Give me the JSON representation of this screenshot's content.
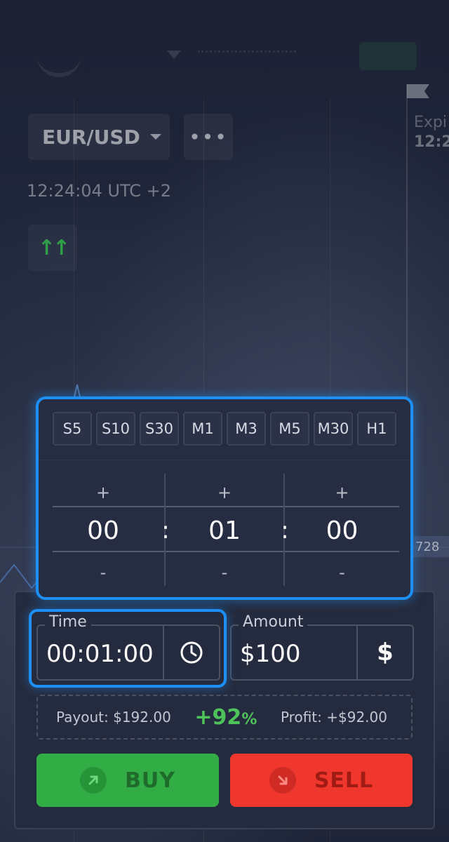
{
  "header": {
    "asset_label": "EUR/USD",
    "more_label": "•••",
    "server_time": "12:24:04 UTC +2",
    "trend_icon": "double-arrow-up-icon",
    "expiry_label": "Expi",
    "expiry_time": "12:2",
    "price_tag": "728"
  },
  "duration_picker": {
    "presets": [
      "S5",
      "S10",
      "S30",
      "M1",
      "M3",
      "M5",
      "M30",
      "H1"
    ],
    "plus_label": "+",
    "minus_label": "-",
    "separator": ":",
    "hours": "00",
    "minutes": "01",
    "seconds": "00"
  },
  "trade": {
    "time_label": "Time",
    "time_value": "00:01:00",
    "time_icon": "clock-icon",
    "amount_label": "Amount",
    "amount_value": "$100",
    "amount_icon": "dollar-icon",
    "payout_text": "Payout: $192.00",
    "payout_percent": "+92",
    "payout_percent_unit": "%",
    "profit_text": "Profit: +$92.00",
    "buy_label": "BUY",
    "sell_label": "SELL"
  },
  "colors": {
    "background": "#1b2033",
    "accent_focus": "#1e8ff5",
    "buy": "#32ad46",
    "sell": "#f0372e",
    "payout_green": "#4dc35a"
  }
}
